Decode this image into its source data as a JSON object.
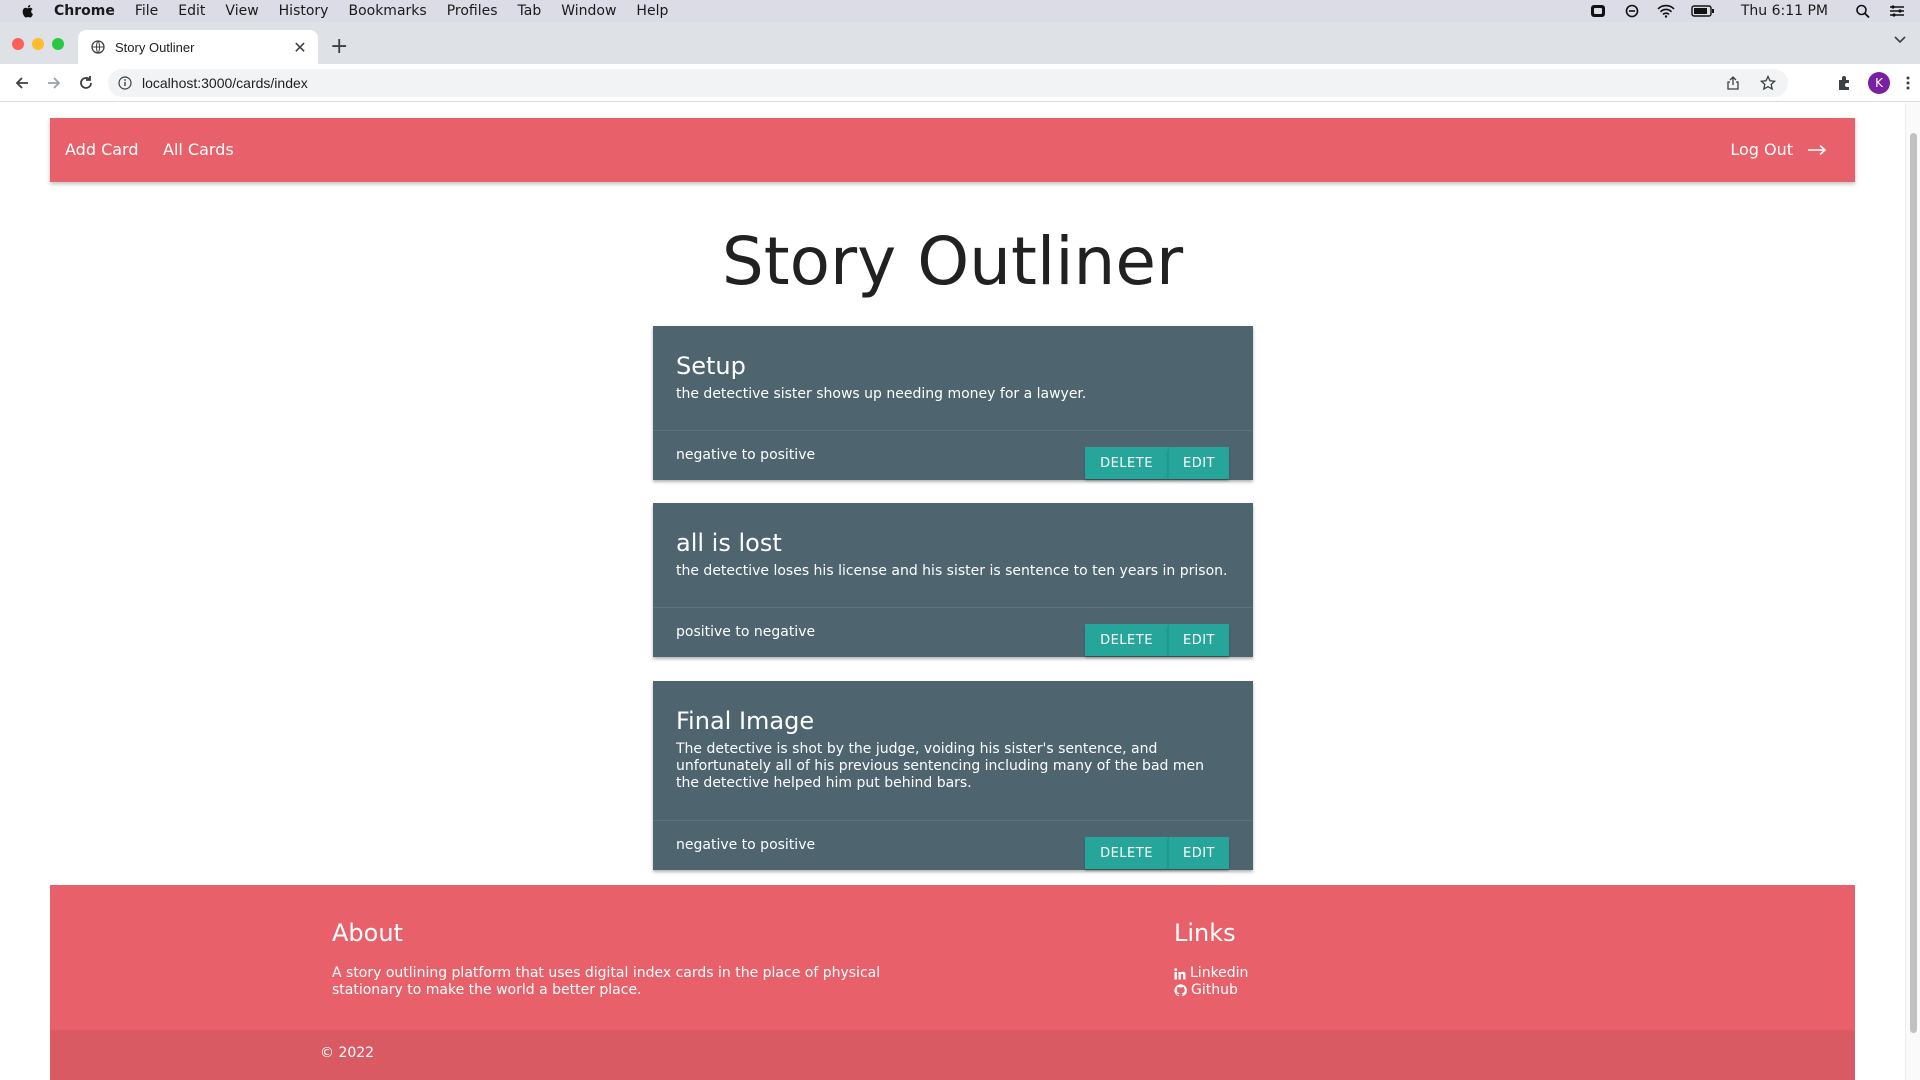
{
  "menubar": {
    "app": "Chrome",
    "items": [
      "File",
      "Edit",
      "View",
      "History",
      "Bookmarks",
      "Profiles",
      "Tab",
      "Window",
      "Help"
    ],
    "clock": "Thu 6:11 PM"
  },
  "browser": {
    "tab_title": "Story Outliner",
    "url": "localhost:3000/cards/index",
    "avatar_letter": "K"
  },
  "nav": {
    "add_card": "Add Card",
    "all_cards": "All Cards",
    "logout": "Log Out"
  },
  "page": {
    "title": "Story Outliner"
  },
  "cards": [
    {
      "title": "Setup",
      "text": "the detective sister shows up needing money for a lawyer.",
      "arc": "negative to positive",
      "delete_label": "DELETE",
      "edit_label": "EDIT"
    },
    {
      "title": "all is lost",
      "text": "the detective loses his license and his sister is sentence to ten years in prison.",
      "arc": "positive to negative",
      "delete_label": "DELETE",
      "edit_label": "EDIT"
    },
    {
      "title": "Final Image",
      "text": "The detective is shot by the judge, voiding his sister's sentence, and unfortunately all of his previous sentencing including many of the bad men the detective helped him put behind bars.",
      "arc": "negative to positive",
      "delete_label": "DELETE",
      "edit_label": "EDIT"
    }
  ],
  "footer": {
    "about_heading": "About",
    "about_text": "A story outlining platform that uses digital index cards in the place of physical stationary to make the world a better place.",
    "links_heading": "Links",
    "links": [
      "Linkedin",
      "Github"
    ],
    "copyright": "© 2022"
  },
  "colors": {
    "brand": "#e8606a",
    "card": "#4e6570",
    "button": "#26a69a"
  }
}
